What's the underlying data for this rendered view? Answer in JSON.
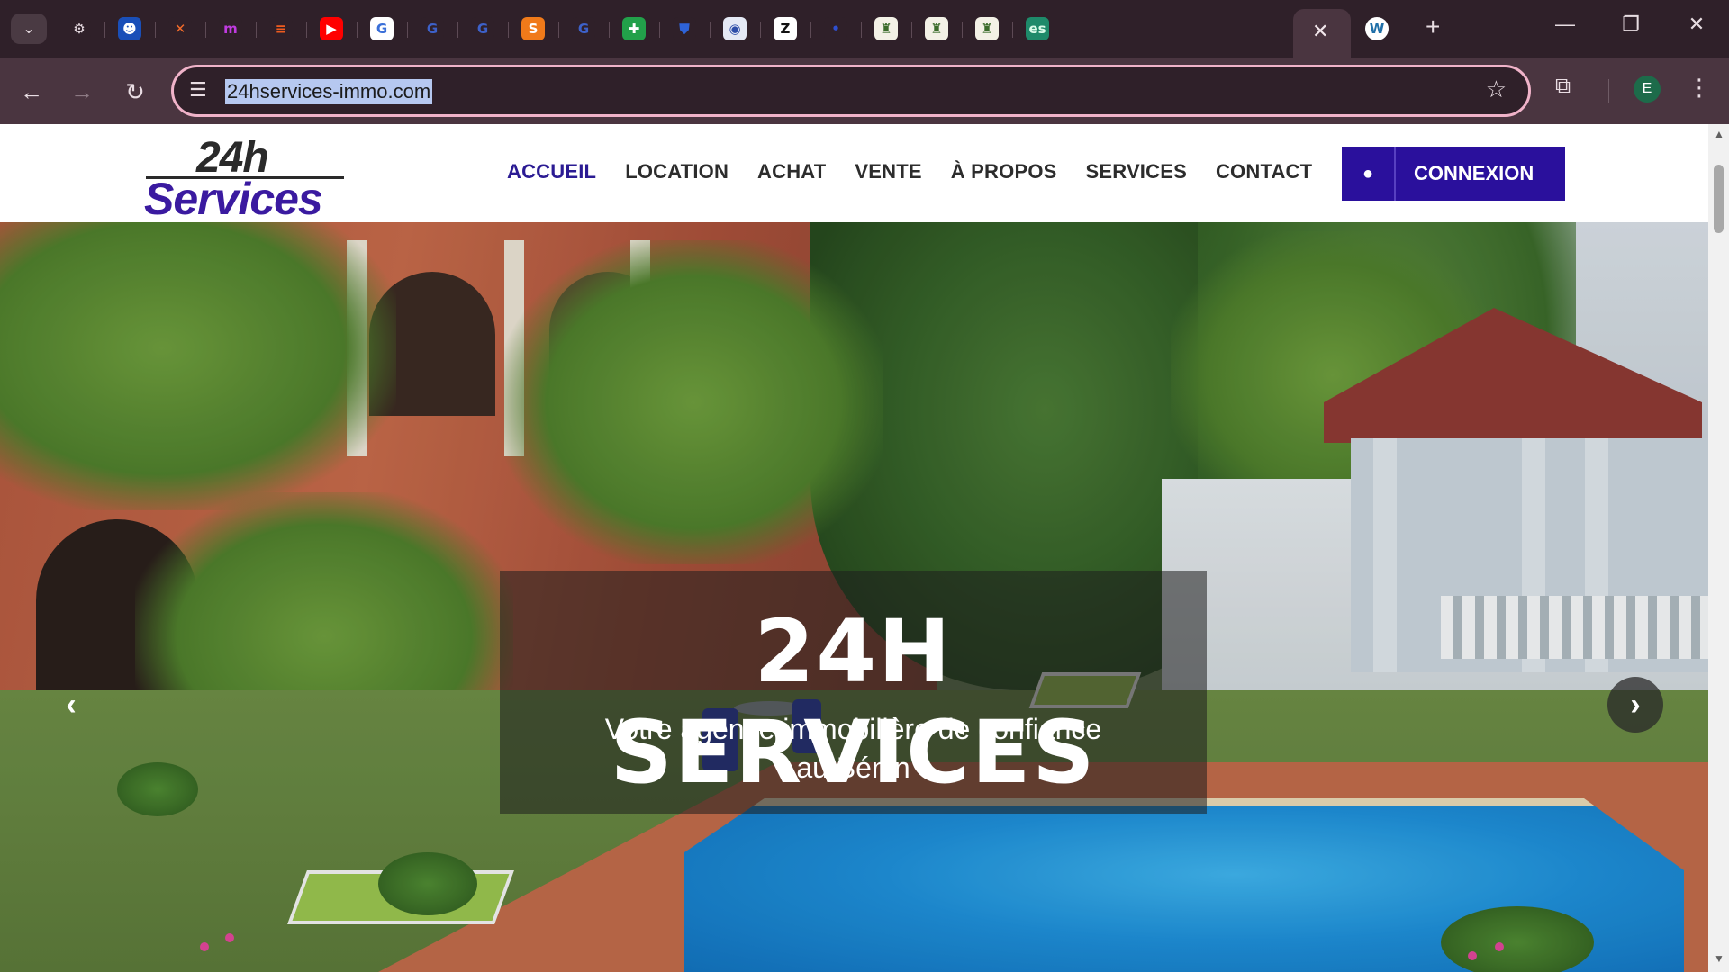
{
  "browser": {
    "tabs_menu_icon": "chevron-down-icon",
    "tabs": [
      {
        "icon": "openai-icon",
        "glyph": "⚙",
        "color": "#2f2029",
        "fg": "#e9dde3"
      },
      {
        "icon": "ghost-icon",
        "glyph": "☻",
        "color": "#1a4fb8",
        "fg": "#ffffff"
      },
      {
        "icon": "cross-icon",
        "glyph": "✕",
        "color": "#2f2029",
        "fg": "#f06a2a"
      },
      {
        "icon": "m-icon",
        "glyph": "m",
        "color": "#2f2029",
        "fg": "#c03be0"
      },
      {
        "icon": "stack-icon",
        "glyph": "≡",
        "color": "#2f2029",
        "fg": "#ef5b1f"
      },
      {
        "icon": "youtube-icon",
        "glyph": "▶",
        "color": "#ff0000",
        "fg": "#ffffff"
      },
      {
        "icon": "gg-icon",
        "glyph": "G",
        "color": "#ffffff",
        "fg": "#3a6fd8"
      },
      {
        "icon": "gg-icon",
        "glyph": "G",
        "color": "#2f2029",
        "fg": "#3d61c9"
      },
      {
        "icon": "gg-icon",
        "glyph": "G",
        "color": "#2f2029",
        "fg": "#3d61c9"
      },
      {
        "icon": "s-icon",
        "glyph": "S",
        "color": "#f07a1a",
        "fg": "#ffffff"
      },
      {
        "icon": "gg-icon",
        "glyph": "G",
        "color": "#2f2029",
        "fg": "#3d61c9"
      },
      {
        "icon": "plus-sheet-icon",
        "glyph": "✚",
        "color": "#22a04a",
        "fg": "#ffffff"
      },
      {
        "icon": "shield-icon",
        "glyph": "⛊",
        "color": "#2f2029",
        "fg": "#2e63d8"
      },
      {
        "icon": "globe-icon",
        "glyph": "◉",
        "color": "#e5e9f5",
        "fg": "#2d4da8"
      },
      {
        "icon": "z-icon",
        "glyph": "Z",
        "color": "#ffffff",
        "fg": "#111111"
      },
      {
        "icon": "dot-icon",
        "glyph": "•",
        "color": "#2f2029",
        "fg": "#2e4fd0"
      },
      {
        "icon": "crest-icon",
        "glyph": "♜",
        "color": "#f3f1e6",
        "fg": "#3a6b2a"
      },
      {
        "icon": "crest-icon",
        "glyph": "♜",
        "color": "#f3f1e6",
        "fg": "#3a6b2a"
      },
      {
        "icon": "crest-icon",
        "glyph": "♜",
        "color": "#f3f1e6",
        "fg": "#3a6b2a"
      },
      {
        "icon": "es-icon",
        "glyph": "es",
        "color": "#1e8a6a",
        "fg": "#d9fbe9"
      }
    ],
    "active_tab_close_icon": "close-icon",
    "wordpress_tab_icon": "wordpress-icon",
    "new_tab_icon": "plus-icon",
    "window_controls": [
      "minimize-icon",
      "restore-icon",
      "close-window-icon"
    ],
    "address_bar": {
      "url": "24hservices-immo.com",
      "site_info_icon": "tune-icon",
      "bookmark_icon": "star-icon"
    },
    "profile_initial": "E"
  },
  "site": {
    "logo": {
      "top": "24h",
      "bottom": "Services"
    },
    "nav": [
      {
        "label": "ACCUEIL",
        "active": true
      },
      {
        "label": "LOCATION",
        "active": false
      },
      {
        "label": "ACHAT",
        "active": false
      },
      {
        "label": "VENTE",
        "active": false
      },
      {
        "label": "À PROPOS",
        "active": false
      },
      {
        "label": "SERVICES",
        "active": false
      },
      {
        "label": "CONTACT",
        "active": false
      }
    ],
    "login_label": "CONNEXION",
    "login_icon": "user-circle-icon",
    "hero": {
      "title": "24H SERVICES",
      "subtitle": "Votre agence immobilière de confiance au Bénin",
      "prev_icon": "chevron-left-icon",
      "next_icon": "chevron-right-icon"
    },
    "colors": {
      "brand": "#2a109c",
      "nav_active": "#2b1b93",
      "nav_text": "#2c2c2c"
    }
  }
}
